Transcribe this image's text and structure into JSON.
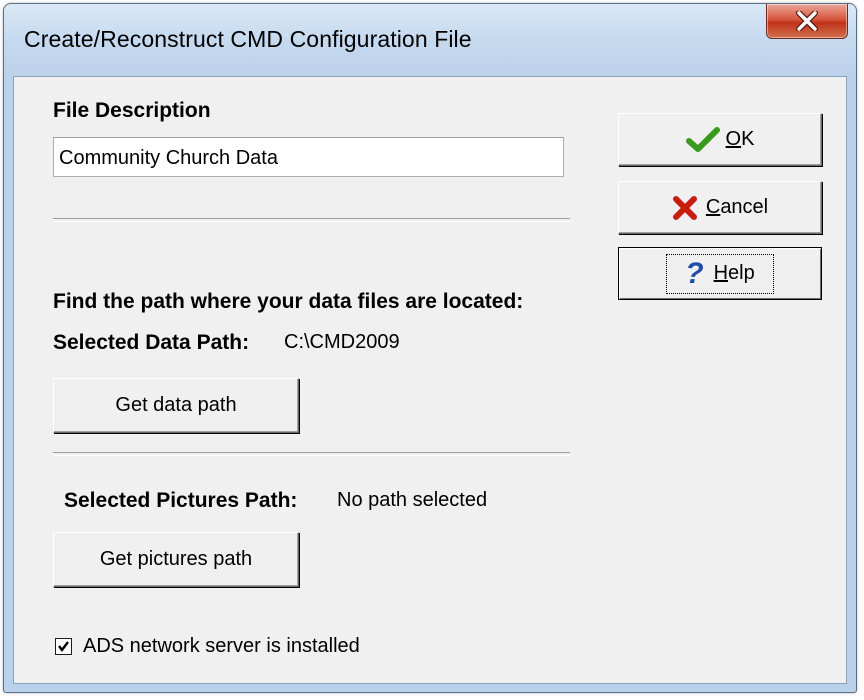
{
  "window": {
    "title": "Create/Reconstruct CMD Configuration File"
  },
  "file_description": {
    "label": "File Description",
    "value": "Community Church Data"
  },
  "data_path": {
    "heading": "Find the path where your data files are located:",
    "label": "Selected Data Path:",
    "value": "C:\\CMD2009",
    "button": "Get data path"
  },
  "pictures_path": {
    "label": "Selected Pictures Path:",
    "value": "No path selected",
    "button": "Get pictures path"
  },
  "ads": {
    "label": "ADS network server is installed",
    "checked": true
  },
  "buttons": {
    "ok": {
      "mnemonic": "O",
      "rest": "K",
      "icon": "green-checkmark-icon"
    },
    "cancel": {
      "mnemonic": "C",
      "rest": "ancel",
      "icon": "red-x-icon"
    },
    "help": {
      "mnemonic": "H",
      "rest": "elp",
      "icon": "question-mark-icon"
    }
  },
  "colors": {
    "ok_icon": "#3a9a1e",
    "cancel_icon": "#c81d11",
    "help_icon": "#1f4ea8",
    "close_button": "#c7432a"
  }
}
